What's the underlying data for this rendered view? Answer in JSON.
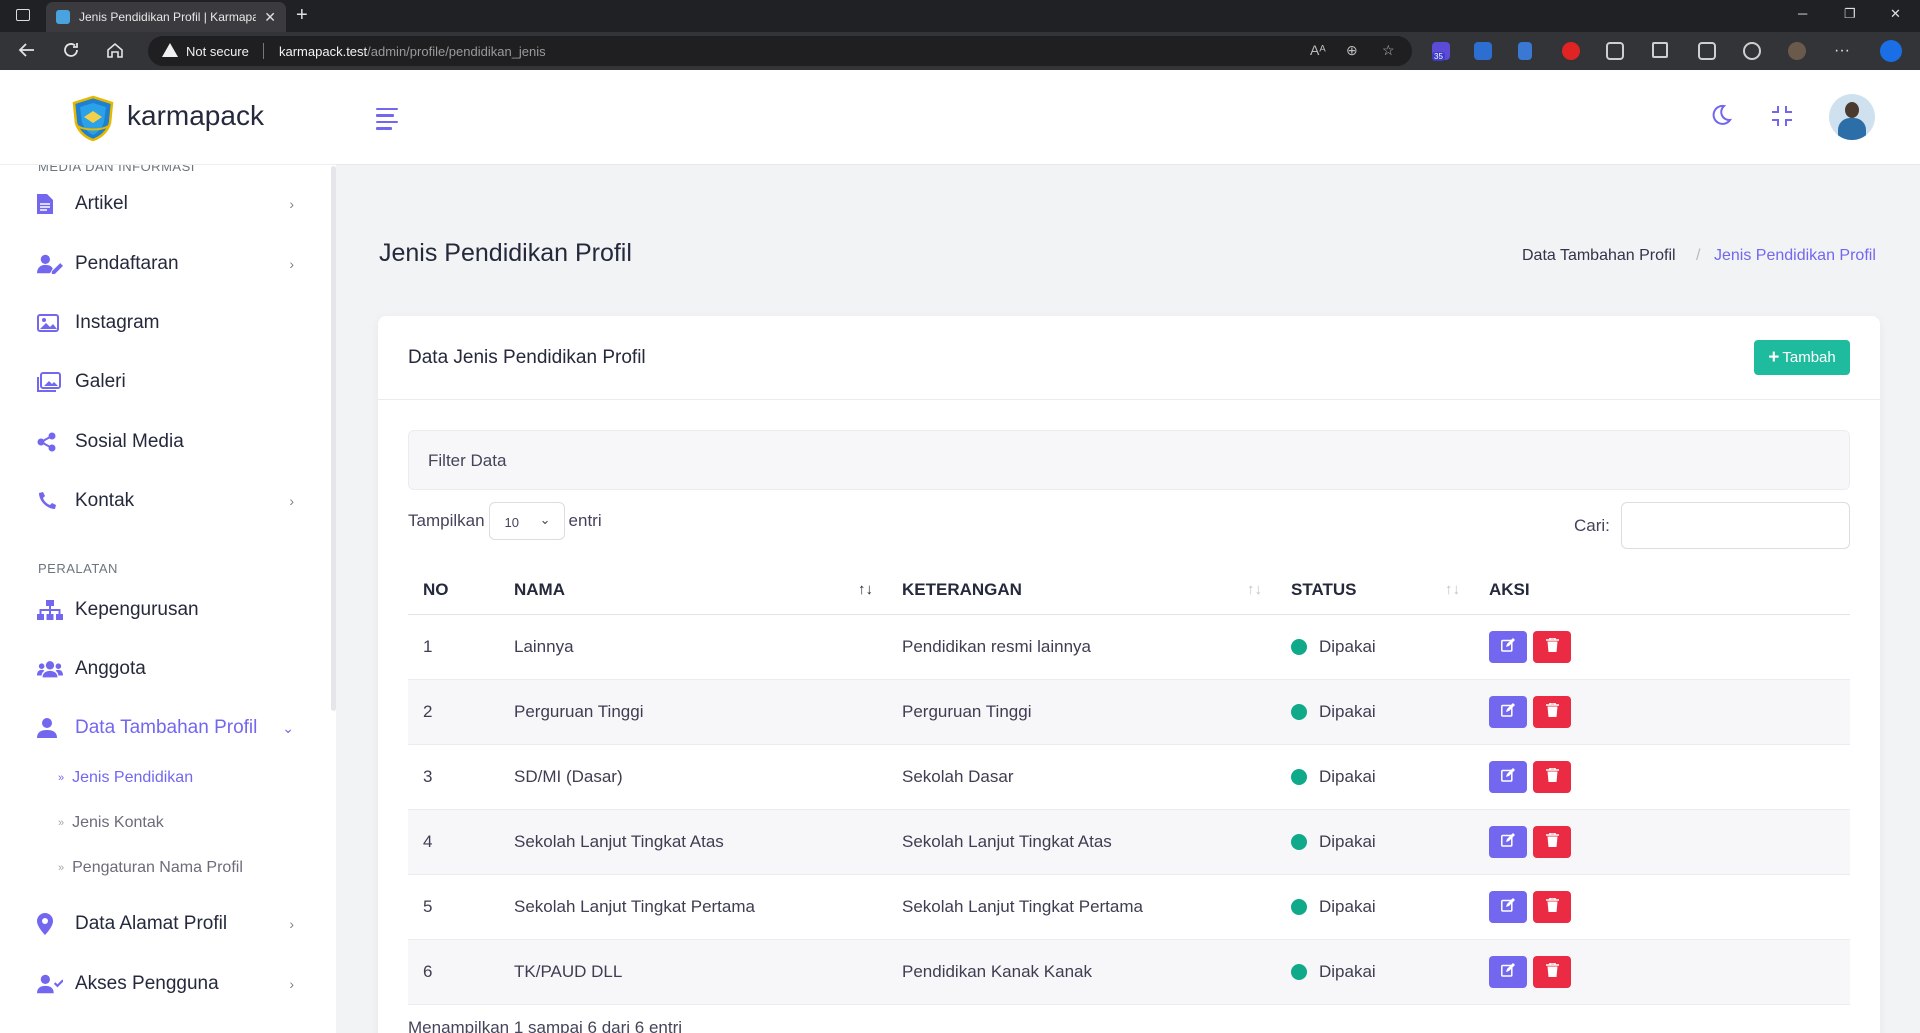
{
  "browser": {
    "tab_title": "Jenis Pendidikan Profil | Karmapack",
    "tab_close": "✕",
    "new_tab": "+",
    "security_label": "Not secure",
    "url_host": "karmapack.test",
    "url_path": "/admin/profile/pendidikan_jenis",
    "ext_badge": "35",
    "window_min": "─",
    "window_max": "❐",
    "window_close": "✕",
    "more": "···"
  },
  "app": {
    "brand": "karmapack"
  },
  "sidebar": {
    "cut_section": "MEDIA DAN INFORMASI",
    "media_items": [
      {
        "label": "Artikel",
        "icon": "file-icon",
        "chevron": "›"
      },
      {
        "label": "Pendaftaran",
        "icon": "user-edit-icon",
        "chevron": "›"
      },
      {
        "label": "Instagram",
        "icon": "image-icon",
        "chevron": ""
      },
      {
        "label": "Galeri",
        "icon": "images-icon",
        "chevron": ""
      },
      {
        "label": "Sosial Media",
        "icon": "share-icon",
        "chevron": ""
      },
      {
        "label": "Kontak",
        "icon": "phone-icon",
        "chevron": "›"
      }
    ],
    "tools_section": "PERALATAN",
    "tools_items": [
      {
        "label": "Kepengurusan",
        "icon": "sitemap-icon",
        "chevron": ""
      },
      {
        "label": "Anggota",
        "icon": "users-icon",
        "chevron": ""
      },
      {
        "label": "Data Tambahan Profil",
        "icon": "user-icon",
        "chevron": "⌄"
      }
    ],
    "sub_items": [
      "Jenis Pendidikan",
      "Jenis Kontak",
      "Pengaturan Nama Profil"
    ],
    "bottom_items": [
      {
        "label": "Data Alamat Profil",
        "icon": "map-pin-icon",
        "chevron": "›"
      },
      {
        "label": "Akses Pengguna",
        "icon": "user-check-icon",
        "chevron": "›"
      }
    ]
  },
  "page": {
    "title": "Jenis Pendidikan Profil",
    "breadcrumb": [
      "Data Tambahan Profil",
      "/",
      "Jenis Pendidikan Profil"
    ]
  },
  "card": {
    "title": "Data Jenis Pendidikan Profil",
    "add_button": "Tambah",
    "add_plus": "+",
    "filter_label": "Filter Data",
    "length_prefix": "Tampilkan",
    "length_value": "10",
    "length_suffix": "entri",
    "search_label": "Cari:",
    "columns": [
      "NO",
      "NAMA",
      "KETERANGAN",
      "STATUS",
      "AKSI"
    ],
    "sort_icon": "↑↓",
    "rows": [
      {
        "no": "1",
        "nama": "Lainnya",
        "keterangan": "Pendidikan resmi lainnya",
        "status": "Dipakai"
      },
      {
        "no": "2",
        "nama": "Perguruan Tinggi",
        "keterangan": "Perguruan Tinggi",
        "status": "Dipakai"
      },
      {
        "no": "3",
        "nama": "SD/MI (Dasar)",
        "keterangan": "Sekolah Dasar",
        "status": "Dipakai"
      },
      {
        "no": "4",
        "nama": "Sekolah Lanjut Tingkat Atas",
        "keterangan": "Sekolah Lanjut Tingkat Atas",
        "status": "Dipakai"
      },
      {
        "no": "5",
        "nama": "Sekolah Lanjut Tingkat Pertama",
        "keterangan": "Sekolah Lanjut Tingkat Pertama",
        "status": "Dipakai"
      },
      {
        "no": "6",
        "nama": "TK/PAUD DLL",
        "keterangan": "Pendidikan Kanak Kanak",
        "status": "Dipakai"
      }
    ],
    "info": "Menampilkan 1 sampai 6 dari 6 entri"
  },
  "colors": {
    "accent": "#7367f0",
    "success": "#1fbb9f",
    "danger": "#ea2b43",
    "status_dot": "#10a98a"
  }
}
